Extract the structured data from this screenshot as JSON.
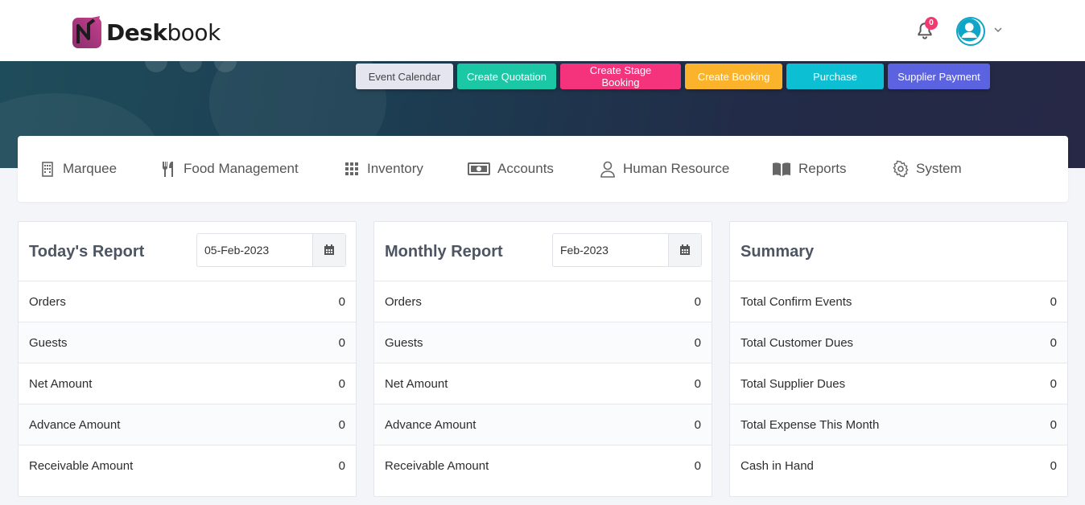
{
  "app": {
    "logo_desk": "Desk",
    "logo_book": "book"
  },
  "header": {
    "notification_count": "0",
    "notification_icon": "bell-icon",
    "avatar_icon": "user-icon"
  },
  "actions": [
    {
      "label": "Event Calendar",
      "color": "#e4e5ef"
    },
    {
      "label": "Create Quotation",
      "color": "#1cc7a6"
    },
    {
      "label": "Create Stage Booking",
      "color": "#f5327c"
    },
    {
      "label": "Create Booking",
      "color": "#fbb32b"
    },
    {
      "label": "Purchase",
      "color": "#0dbfd3"
    },
    {
      "label": "Supplier Payment",
      "color": "#5b63e0"
    }
  ],
  "modules": [
    {
      "label": "Marquee",
      "icon": "building-icon"
    },
    {
      "label": "Food Management",
      "icon": "utensils-icon"
    },
    {
      "label": "Inventory",
      "icon": "grid-icon"
    },
    {
      "label": "Accounts",
      "icon": "money-icon"
    },
    {
      "label": "Human Resource",
      "icon": "person-icon"
    },
    {
      "label": "Reports",
      "icon": "book-icon"
    },
    {
      "label": "System",
      "icon": "gear-icon"
    }
  ],
  "today_report": {
    "title": "Today's Report",
    "date": "05-Feb-2023",
    "rows": [
      {
        "label": "Orders",
        "value": "0"
      },
      {
        "label": "Guests",
        "value": "0"
      },
      {
        "label": "Net Amount",
        "value": "0"
      },
      {
        "label": "Advance Amount",
        "value": "0"
      },
      {
        "label": "Receivable Amount",
        "value": "0"
      }
    ]
  },
  "monthly_report": {
    "title": "Monthly Report",
    "date": "Feb-2023",
    "rows": [
      {
        "label": "Orders",
        "value": "0"
      },
      {
        "label": "Guests",
        "value": "0"
      },
      {
        "label": "Net Amount",
        "value": "0"
      },
      {
        "label": "Advance Amount",
        "value": "0"
      },
      {
        "label": "Receivable Amount",
        "value": "0"
      }
    ]
  },
  "summary": {
    "title": "Summary",
    "rows": [
      {
        "label": "Total Confirm Events",
        "value": "0"
      },
      {
        "label": "Total Customer Dues",
        "value": "0"
      },
      {
        "label": "Total Supplier Dues",
        "value": "0"
      },
      {
        "label": "Total Expense This Month",
        "value": "0"
      },
      {
        "label": "Cash in Hand",
        "value": "0"
      }
    ]
  }
}
